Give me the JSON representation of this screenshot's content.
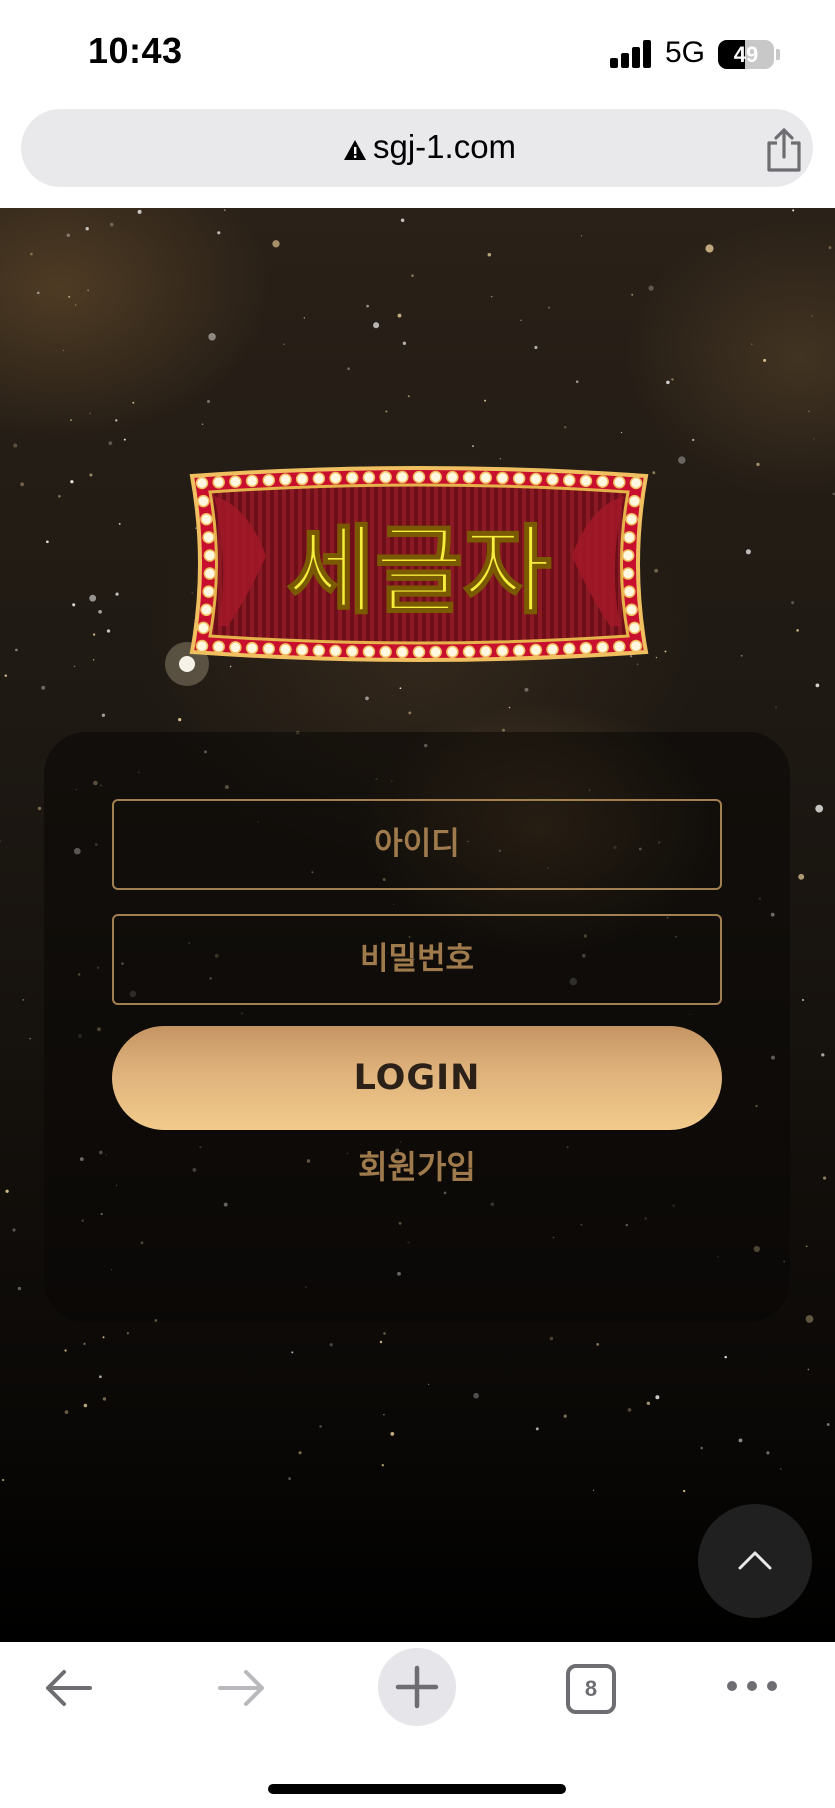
{
  "status_bar": {
    "time": "10:43",
    "network": "5G",
    "battery_percent": "49",
    "battery_level": 0.49,
    "icons": [
      "signal-icon",
      "battery-icon"
    ]
  },
  "browser": {
    "url": "sgj-1.com",
    "url_warning_icon": "warning-triangle-icon",
    "share_icon": "share-icon"
  },
  "site": {
    "logo_text": "세글자",
    "colors": {
      "logo_text": "#f6ee3c",
      "logo_frame": "#c8102e",
      "accent_gold": "#a27f51",
      "button_gradient_top": "#c49563",
      "button_gradient_bottom": "#f2cb8c"
    }
  },
  "login": {
    "id_placeholder": "아이디",
    "password_placeholder": "비밀번호",
    "login_button": "LOGIN",
    "signup_link": "회원가입"
  },
  "scroll_top": {
    "icon": "chevron-up-icon"
  },
  "toolbar": {
    "back_icon": "arrow-left-icon",
    "forward_icon": "arrow-right-icon",
    "new_tab_icon": "plus-icon",
    "tab_count": "8",
    "more_icon": "more-icon"
  }
}
